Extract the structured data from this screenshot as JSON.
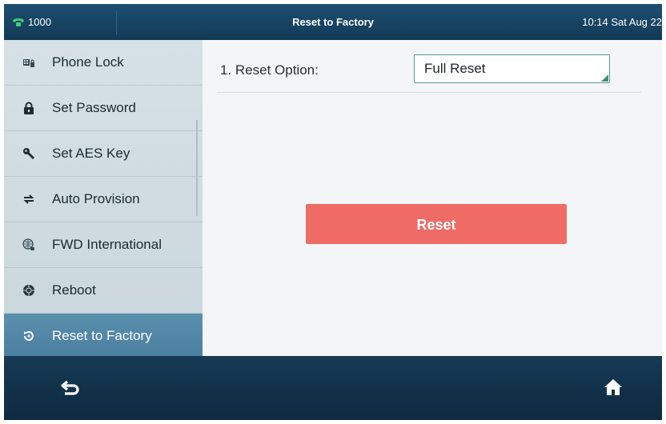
{
  "status_bar": {
    "extension": "1000",
    "title": "Reset to Factory",
    "datetime": "10:14 Sat Aug 22"
  },
  "sidebar": {
    "items": [
      {
        "label": "Phone Lock",
        "icon": "phone-lock-icon"
      },
      {
        "label": "Set Password",
        "icon": "lock-icon"
      },
      {
        "label": "Set AES Key",
        "icon": "key-icon"
      },
      {
        "label": "Auto Provision",
        "icon": "sync-icon"
      },
      {
        "label": "FWD International",
        "icon": "globe-phone-icon"
      },
      {
        "label": "Reboot",
        "icon": "reboot-icon"
      },
      {
        "label": "Reset to Factory",
        "icon": "reset-icon",
        "active": true
      }
    ]
  },
  "main": {
    "reset_option_label": "1. Reset Option:",
    "reset_option_value": "Full Reset",
    "reset_button": "Reset"
  },
  "bottom_bar": {
    "back_icon": "back-arrow-icon",
    "home_icon": "home-icon"
  },
  "colors": {
    "accent": "#ee6b66",
    "active_item": "#4f86a6",
    "status_green": "#3fd17a"
  }
}
